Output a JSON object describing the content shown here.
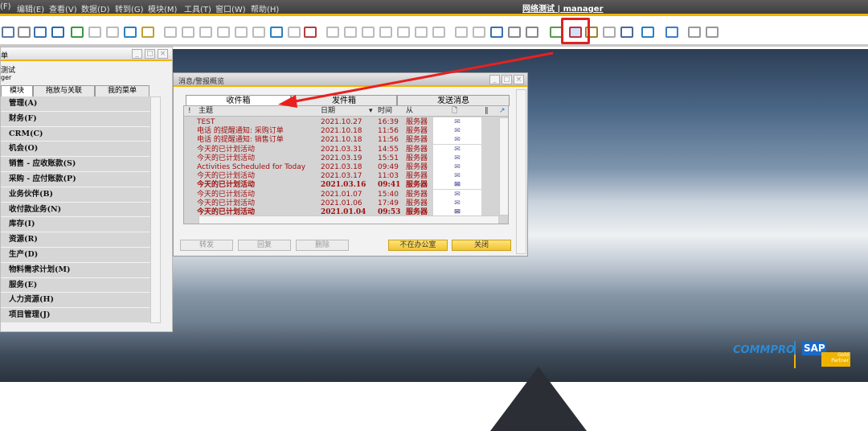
{
  "menubar": {
    "items": [
      "(F)",
      "编辑(E)",
      "查看(V)",
      "数据(D)",
      "转到(G)",
      "模块(M)",
      "工具(T)",
      "窗口(W)",
      "帮助(H)"
    ],
    "title": "网络测试 | manager"
  },
  "toolbar": {
    "highlighted_icon": "messages-alerts-icon",
    "highlight_color": "#e02020"
  },
  "left_panel": {
    "title": "单",
    "company": "测试",
    "user": "ger",
    "tabs": [
      "模块",
      "拖放与关联",
      "我的菜单"
    ],
    "modules": [
      "管理(A)",
      "财务(F)",
      "CRM(C)",
      "机会(O)",
      "销售 - 应收账款(S)",
      "采购 - 应付账款(P)",
      "业务伙伴(B)",
      "收付款业务(N)",
      "库存(I)",
      "资源(R)",
      "生产(D)",
      "物料需求计划(M)",
      "服务(E)",
      "人力资源(H)",
      "项目管理(J)"
    ]
  },
  "dialog": {
    "title": "消息/警报概览",
    "tabs": [
      "收件箱",
      "发件箱",
      "发送消息"
    ],
    "columns": {
      "flag": "!",
      "subject": "主题",
      "date": "日期",
      "time": "时间",
      "from": "从"
    },
    "rows": [
      {
        "subject": "TEST",
        "date": "2021.10.27",
        "time": "16:39",
        "from": "服务器",
        "read": true
      },
      {
        "subject": "电话 的提醒通知: 采购订单",
        "date": "2021.10.18",
        "time": "11:56",
        "from": "服务器",
        "read": true
      },
      {
        "subject": "电话 的提醒通知: 销售订单",
        "date": "2021.10.18",
        "time": "11:56",
        "from": "服务器",
        "read": true
      },
      {
        "subject": "今天的已计划活动",
        "date": "2021.03.31",
        "time": "14:55",
        "from": "服务器",
        "read": true
      },
      {
        "subject": "今天的已计划活动",
        "date": "2021.03.19",
        "time": "15:51",
        "from": "服务器",
        "read": true
      },
      {
        "subject": "Activities Scheduled for Today",
        "date": "2021.03.18",
        "time": "09:49",
        "from": "服务器",
        "read": true
      },
      {
        "subject": "今天的已计划活动",
        "date": "2021.03.17",
        "time": "11:03",
        "from": "服务器",
        "read": true
      },
      {
        "subject": "今天的已计划活动",
        "date": "2021.03.16",
        "time": "09:41",
        "from": "服务器",
        "read": false
      },
      {
        "subject": "今天的已计划活动",
        "date": "2021.01.07",
        "time": "15:40",
        "from": "服务器",
        "read": true
      },
      {
        "subject": "今天的已计划活动",
        "date": "2021.01.06",
        "time": "17:49",
        "from": "服务器",
        "read": true
      },
      {
        "subject": "今天的已计划活动",
        "date": "2021.01.04",
        "time": "09:53",
        "from": "服务器",
        "read": false
      }
    ],
    "buttons": {
      "forward": "转发",
      "reply": "回复",
      "delete": "删除",
      "out_of_office": "不在办公室",
      "close": "关闭"
    }
  },
  "logos": {
    "commpro": "COMMPRO 工博科技",
    "sap": "SAP Gold Partner"
  }
}
